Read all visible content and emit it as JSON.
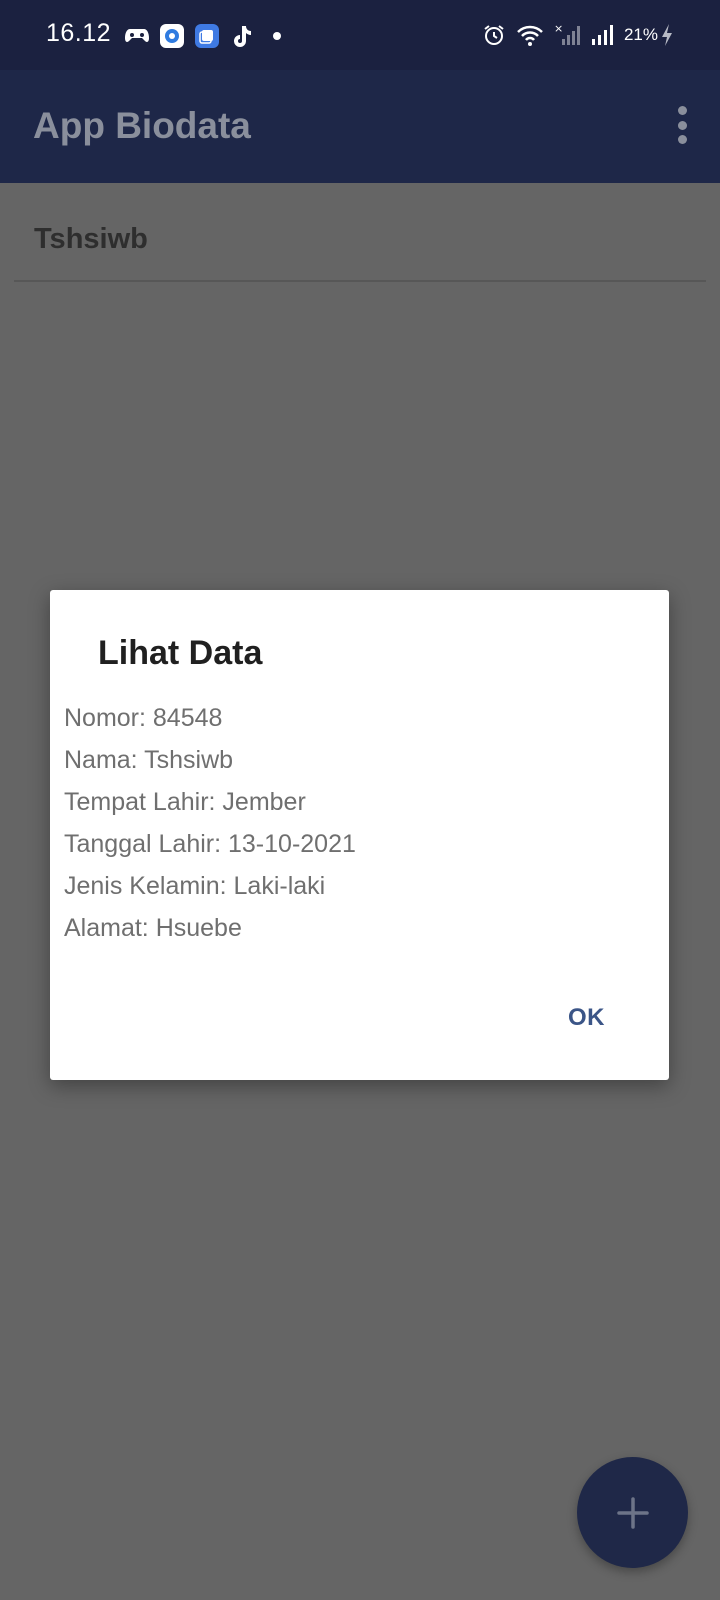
{
  "status_bar": {
    "time": "16.12",
    "left_icons": [
      "game-controller-icon",
      "chrome-like-icon",
      "copy-app-icon",
      "tiktok-icon",
      "more-notifications-dot-icon"
    ],
    "right_icons": [
      "alarm-icon",
      "wifi-icon",
      "sim-no-signal-icon",
      "cell-signal-icon",
      "charging-bolt-icon"
    ],
    "battery": "21%"
  },
  "app_bar": {
    "title": "App Biodata",
    "menu_icon": "more-vert-icon"
  },
  "list": {
    "items": [
      {
        "label": "Tshsiwb"
      }
    ]
  },
  "dialog": {
    "title": "Lihat Data",
    "lines": [
      "Nomor: 84548",
      "Nama: Tshsiwb",
      "Tempat Lahir: Jember",
      "Tanggal Lahir: 13-10-2021",
      "Jenis Kelamin: Laki-laki",
      "Alamat: Hsuebe"
    ],
    "ok_label": "OK"
  },
  "fab": {
    "icon": "plus-icon"
  },
  "colors": {
    "status_bar": "#1b2140",
    "app_bar": "#1e2748",
    "scrim_background": "#656565",
    "dialog_accent": "#3b5587",
    "fab": "#1f2848"
  }
}
